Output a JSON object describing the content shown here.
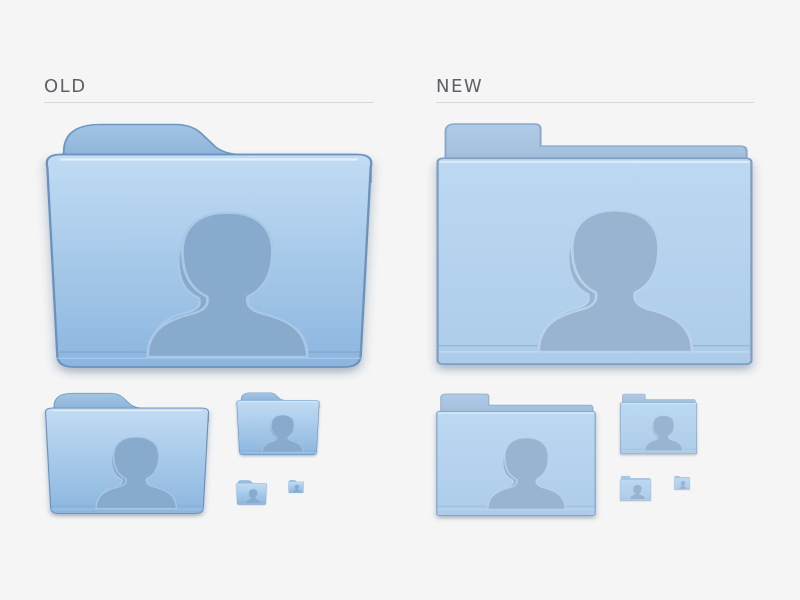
{
  "columns": {
    "old": {
      "label": "OLD"
    },
    "new": {
      "label": "NEW"
    }
  },
  "colors": {
    "background": "#f5f5f5",
    "label_text": "#5e6166",
    "rule": "#d6d6d6",
    "old_front_top": "#bcd9f2",
    "old_front_bottom": "#8fb8e0",
    "old_tab": "#8fb3d8",
    "old_glyph": "#87a9cc",
    "new_front_top": "#bad8f1",
    "new_front_bottom": "#aecdea",
    "new_tab": "#a6c2de",
    "new_glyph": "#97b3cf"
  },
  "icons": {
    "old": [
      "users-folder-icon",
      "users-folder-icon",
      "users-folder-icon",
      "users-folder-icon",
      "users-folder-icon"
    ],
    "new": [
      "users-folder-icon",
      "users-folder-icon",
      "users-folder-icon",
      "users-folder-icon",
      "users-folder-icon"
    ]
  }
}
